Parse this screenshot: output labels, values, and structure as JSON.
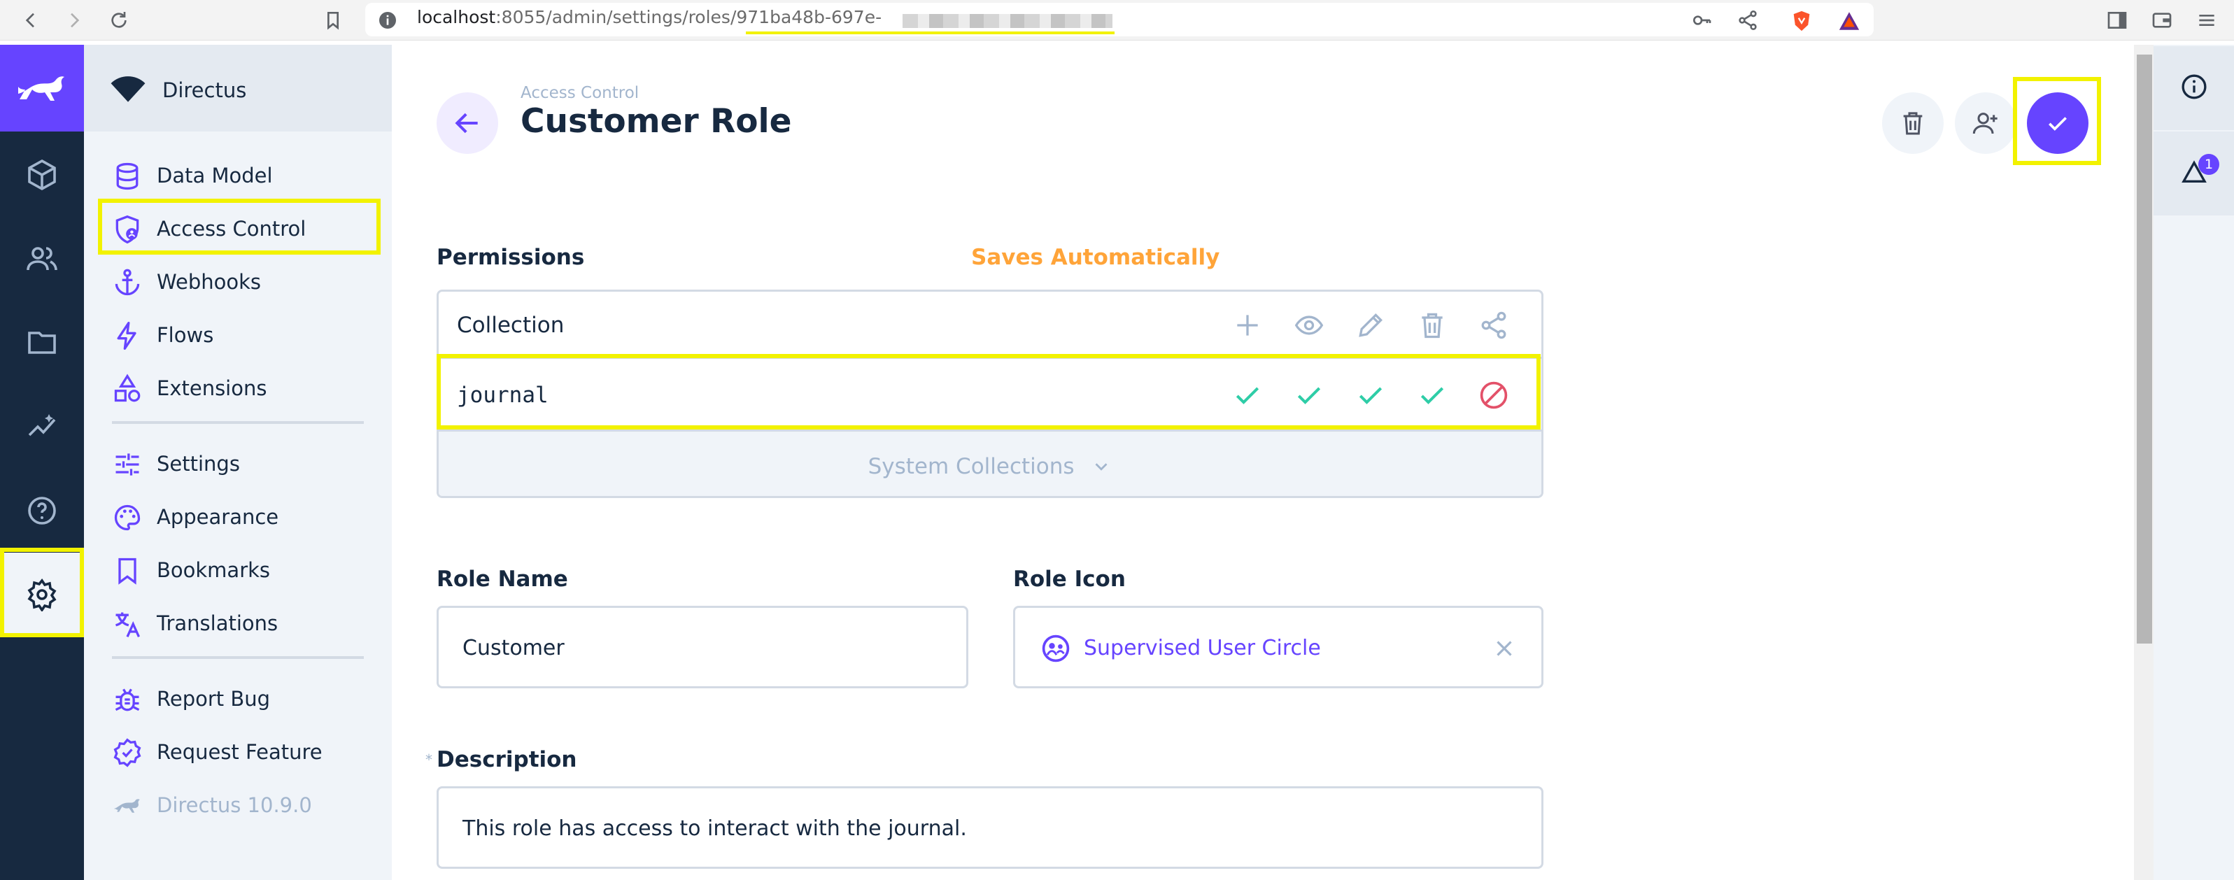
{
  "browser": {
    "url_host": "localhost",
    "url_path": ":8055/admin/settings/roles/971ba48b-697e-"
  },
  "project": {
    "name": "Directus"
  },
  "nav": {
    "group1": [
      {
        "label": "Data Model",
        "icon": "database-icon"
      },
      {
        "label": "Access Control",
        "icon": "shield-person-icon"
      },
      {
        "label": "Webhooks",
        "icon": "anchor-icon"
      },
      {
        "label": "Flows",
        "icon": "bolt-icon"
      },
      {
        "label": "Extensions",
        "icon": "shapes-icon"
      }
    ],
    "group2": [
      {
        "label": "Settings",
        "icon": "tune-icon"
      },
      {
        "label": "Appearance",
        "icon": "palette-icon"
      },
      {
        "label": "Bookmarks",
        "icon": "bookmark-icon"
      },
      {
        "label": "Translations",
        "icon": "translate-icon"
      }
    ],
    "group3": [
      {
        "label": "Report Bug",
        "icon": "bug-icon"
      },
      {
        "label": "Request Feature",
        "icon": "new-releases-icon"
      }
    ],
    "version": "Directus 10.9.0"
  },
  "header": {
    "breadcrumb": "Access Control",
    "title": "Customer Role"
  },
  "permissions": {
    "label": "Permissions",
    "auto_note": "Saves Automatically",
    "column_title": "Collection",
    "actions": [
      "create",
      "read",
      "update",
      "delete",
      "share"
    ],
    "rows": [
      {
        "collection": "journal",
        "create": "all",
        "read": "all",
        "update": "all",
        "delete": "all",
        "share": "none"
      }
    ],
    "system_collections_label": "System Collections"
  },
  "form": {
    "role_name_label": "Role Name",
    "role_name_value": "Customer",
    "role_icon_label": "Role Icon",
    "role_icon_value": "Supervised User Circle",
    "description_label": "Description",
    "description_value": "This role has access to interact with the journal.",
    "required_marker": "*"
  },
  "right_sidebar": {
    "notifications_count": "1"
  },
  "colors": {
    "accent": "#6644ff",
    "success": "#2ecda7",
    "danger": "#e35169",
    "warning": "#ffa439",
    "highlight": "#f2f200",
    "rail": "#172940"
  }
}
